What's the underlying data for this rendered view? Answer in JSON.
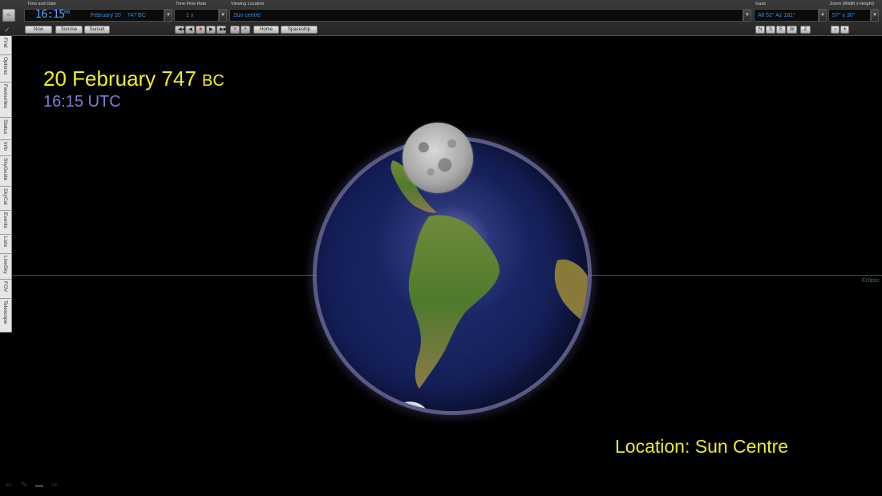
{
  "toolbar": {
    "time_and_date_label": "Time and Date",
    "time_big": "16:15",
    "time_seconds": "00",
    "date_month_day": "February 20",
    "date_year": "747 BC",
    "now_button": "Now",
    "sunrise_button": "Sunrise",
    "sunset_button": "Sunset",
    "time_flow_label": "Time Flow Rate",
    "time_flow_value": "1 x",
    "viewing_location_label": "Viewing Location",
    "viewing_location_value": "Sun centre",
    "home_button": "Home",
    "spaceship_button": "Spaceship",
    "gaze_label": "Gaze",
    "gaze_value": "Alt 52° Az 181°",
    "compass_buttons": [
      "N",
      "S",
      "E",
      "W",
      "Z"
    ],
    "zoom_label": "Zoom (Width x Height)",
    "zoom_value": "57° x 30°",
    "zoom_out": "−",
    "zoom_in": "+"
  },
  "sidebar": {
    "tabs": [
      "Find",
      "Options",
      "Favourites",
      "Status",
      "Info",
      "SkyGuide",
      "SkyCal",
      "Events",
      "Lists",
      "LiveSky",
      "FOV",
      "Telescope"
    ]
  },
  "sky": {
    "date_title": "20 February 747",
    "date_era": "BC",
    "utc_time": "16:15 UTC",
    "location": "Location: Sun Centre",
    "ecliptic_label": "Ecliptic"
  },
  "colors": {
    "date_title": "#f2ee24",
    "utc_time": "#7f7fd8",
    "location": "#ecea2a",
    "ecliptic": "#1e6a2a",
    "lcd_text": "#3b8fe0"
  }
}
